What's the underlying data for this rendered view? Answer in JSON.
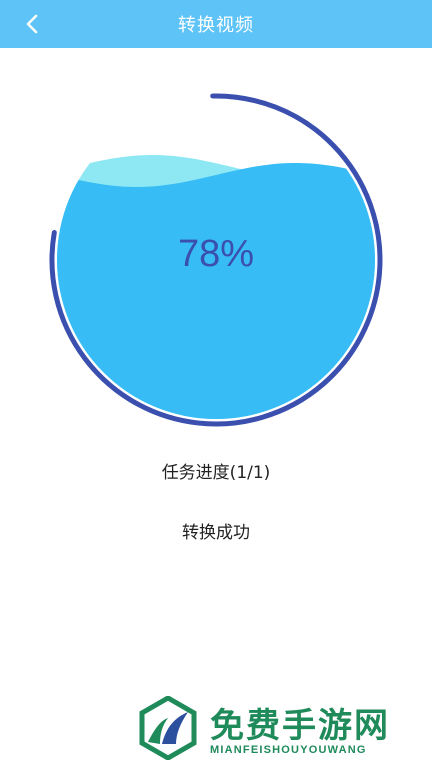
{
  "header": {
    "title": "转换视频",
    "back_icon": "chevron-left-icon"
  },
  "progress": {
    "percent_label": "78%",
    "fraction": 0.78,
    "colors": {
      "liquid": "#37bcf6",
      "wave_back": "#8ee8f3",
      "ring": "#3a4fae",
      "text": "#3a4fae"
    }
  },
  "task": {
    "label": "任务进度(1/1)"
  },
  "status": {
    "label": "转换成功"
  },
  "watermark": {
    "title": "免费手游网",
    "subtitle": "MIANFEISHOUYOUWANG",
    "color": "#1f8a5a"
  }
}
